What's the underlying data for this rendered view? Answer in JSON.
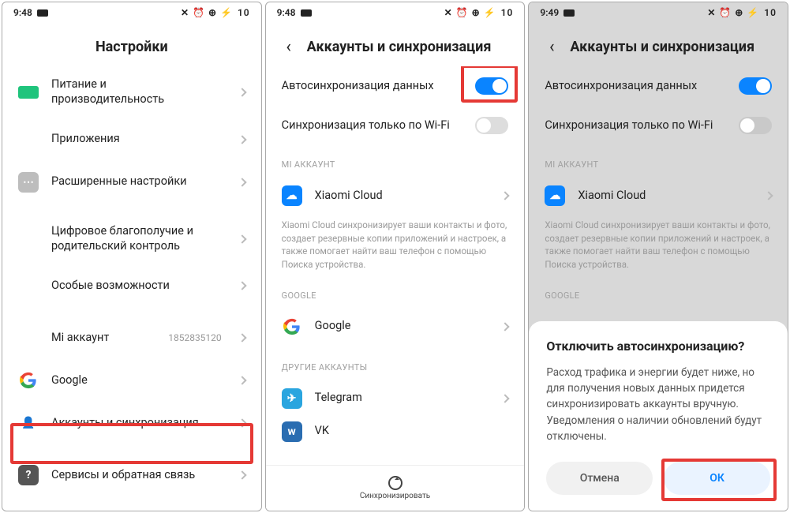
{
  "statusbar": {
    "time_a": "9:48",
    "time_c": "9:49",
    "battery": "10"
  },
  "screen1": {
    "title": "Настройки",
    "rows": {
      "power": "Питание и производительность",
      "apps": "Приложения",
      "extra": "Расширенные настройки",
      "wellbeing": "Цифровое благополучие и родительский контроль",
      "accessibility": "Особые возможности",
      "mi_account": "Mi аккаунт",
      "mi_account_val": "1852835120",
      "google": "Google",
      "accounts": "Аккаунты и синхронизация",
      "services": "Сервисы и обратная связь"
    }
  },
  "screen2": {
    "title": "Аккаунты и синхронизация",
    "autosync": "Автосинхронизация данных",
    "wifi_only": "Синхронизация только по Wi-Fi",
    "section_mi": "MI АККАУНТ",
    "mi_cloud": "Xiaomi Cloud",
    "mi_cloud_desc": "Xiaomi Cloud синхронизирует ваши контакты и фото, создает резервные копии приложений и настроек, а также помогает найти ваш телефон с помощью Поиска устройства.",
    "section_google": "GOOGLE",
    "google": "Google",
    "section_other": "ДРУГИЕ АККАУНТЫ",
    "telegram": "Telegram",
    "vk": "VK",
    "sync_btn": "Синхронизировать"
  },
  "screen3": {
    "title": "Аккаунты и синхронизация",
    "autosync": "Автосинхронизация данных",
    "wifi_only": "Синхронизация только по Wi-Fi",
    "section_mi": "MI АККАУНТ",
    "mi_cloud": "Xiaomi Cloud",
    "mi_cloud_desc": "Xiaomi Cloud синхронизирует ваши контакты и фото, создает резервные копии приложений и настроек, а также помогает найти ваш телефон с помощью Поиска устройства.",
    "section_google": "GOOGLE",
    "dialog": {
      "title": "Отключить автосинхронизацию?",
      "body": "Расход трафика и энергии будет ниже, но для получения новых данных придется синхронизировать аккаунты вручную. Уведомления о наличии обновлений будут отключены.",
      "cancel": "Отмена",
      "ok": "ОК"
    }
  }
}
